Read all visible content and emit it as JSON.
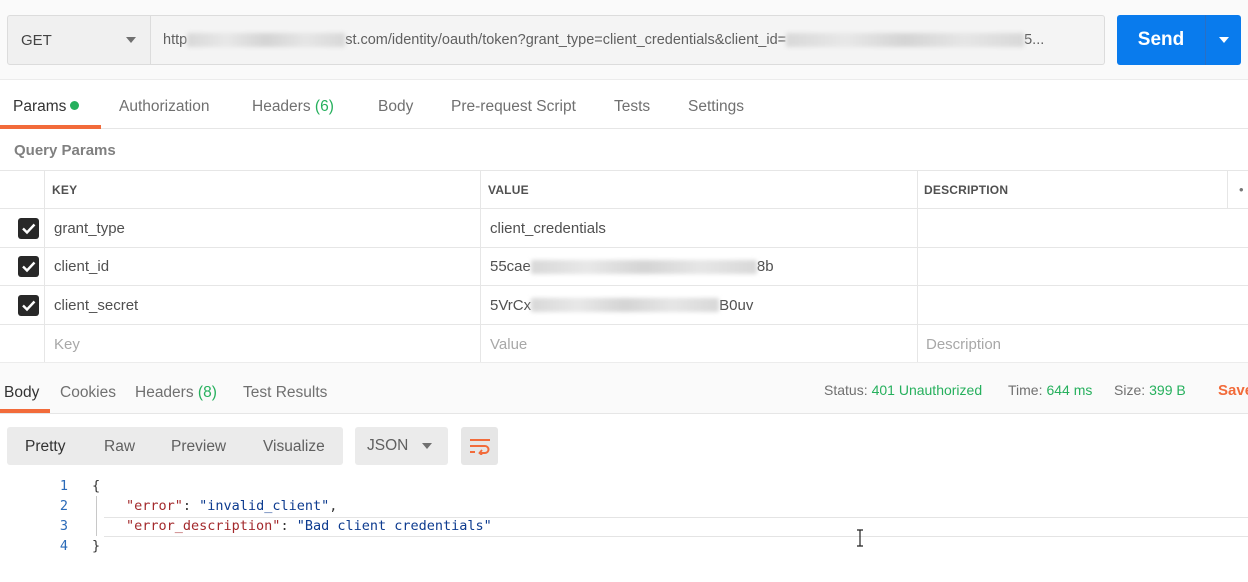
{
  "request": {
    "method": "GET",
    "url_prefix": "http",
    "url_visible": "st.com/identity/oauth/token?grant_type=client_credentials&client_id=",
    "url_suffix": "5...",
    "send_label": "Send"
  },
  "request_tabs": [
    {
      "label": "Params",
      "count": ""
    },
    {
      "label": "Authorization",
      "count": ""
    },
    {
      "label": "Headers",
      "count": "(6)"
    },
    {
      "label": "Body",
      "count": ""
    },
    {
      "label": "Pre-request Script",
      "count": ""
    },
    {
      "label": "Tests",
      "count": ""
    },
    {
      "label": "Settings",
      "count": ""
    }
  ],
  "query_params": {
    "title": "Query Params",
    "columns": {
      "key": "KEY",
      "value": "VALUE",
      "description": "DESCRIPTION"
    },
    "rows": [
      {
        "key": "grant_type",
        "value_prefix": "client_credentials",
        "value_suffix": ""
      },
      {
        "key": "client_id",
        "value_prefix": "55cae",
        "value_suffix": "8b"
      },
      {
        "key": "client_secret",
        "value_prefix": "5VrCx",
        "value_suffix": "B0uv"
      }
    ],
    "placeholders": {
      "key": "Key",
      "value": "Value",
      "description": "Description"
    }
  },
  "response_tabs": [
    {
      "label": "Body",
      "count": ""
    },
    {
      "label": "Cookies",
      "count": ""
    },
    {
      "label": "Headers",
      "count": "(8)"
    },
    {
      "label": "Test Results",
      "count": ""
    }
  ],
  "response_status": {
    "status_label": "Status:",
    "status_value": "401 Unauthorized",
    "time_label": "Time:",
    "time_value": "644 ms",
    "size_label": "Size:",
    "size_value": "399 B",
    "save_label": "Save"
  },
  "format_options": [
    "Pretty",
    "Raw",
    "Preview",
    "Visualize"
  ],
  "language": "JSON",
  "code_lines": [
    {
      "n": "1",
      "open": "{"
    },
    {
      "n": "2",
      "key": "\"error\"",
      "sep": ": ",
      "val": "\"invalid_client\"",
      "end": ","
    },
    {
      "n": "3",
      "key": "\"error_description\"",
      "sep": ": ",
      "val": "\"Bad client credentials\"",
      "end": ""
    },
    {
      "n": "4",
      "open": "}"
    }
  ],
  "colors": {
    "accent": "#f26b3a",
    "send": "#097bed",
    "success": "#26b05d"
  }
}
